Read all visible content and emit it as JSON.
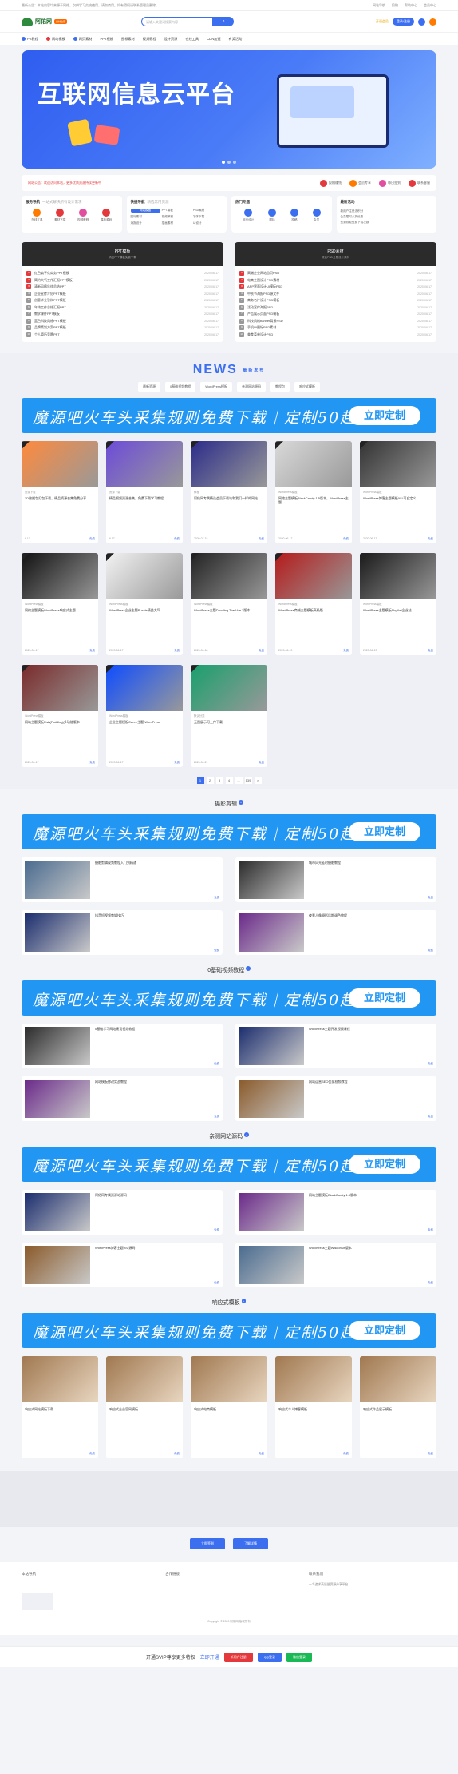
{
  "topbar": {
    "notice": "最新公告：本站内容均来源于网络，仅供学习交流使用，请勿商用。如有侵权请联系管理员删除。",
    "links": [
      "网站导航",
      "投稿",
      "帮助中心",
      "会员中心"
    ]
  },
  "header": {
    "logo": "阿佑网",
    "badge": "素材之家",
    "search_placeholder": "请输入关键词搜索内容",
    "vip": "开通会员",
    "login": "登录/注册"
  },
  "nav": [
    "PS教程",
    "网站模板",
    "网页素材",
    "PPT模板",
    "图标素材",
    "视频教程",
    "设计资源",
    "在线工具",
    "CDN加速",
    "有奖活动"
  ],
  "banner": {
    "title": "互联网信息云平台"
  },
  "strip": {
    "announce": "网站公告：欢迎访问本站，更多优质资源持续更新中",
    "tags": [
      "投稿赚钱",
      "会员专享",
      "每日签到",
      "联系客服"
    ]
  },
  "quick": [
    {
      "title": "服务导航",
      "sub": "一站式解决所有设计需求",
      "icons": [
        "在线工具",
        "素材下载",
        "视频教程",
        "模板源码"
      ]
    },
    {
      "title": "快捷导航",
      "sub": "精选常用资源",
      "links": [
        "网站模板",
        "PPT模板",
        "PSD素材",
        "图标素材",
        "视频教程",
        "字体下载",
        "海报设计",
        "插画素材",
        "UI设计"
      ]
    },
    {
      "title": "热门专题",
      "sub": "",
      "icons": [
        "网页设计",
        "图标",
        "投稿",
        "会员"
      ]
    },
    {
      "title": "最新活动",
      "sub": "",
      "lines": [
        "新用户注册送积分",
        "会员限时八折优惠",
        "签到领取免费下载次数"
      ]
    }
  ],
  "ppt": {
    "title": "PPT模板",
    "sub": "精品PPT模板免费下载",
    "items": [
      "红色扁平化商务PPT模板",
      "简约大气工作汇报PPT模板",
      "清新风格年终总结PPT",
      "企业宣传介绍PPT模板",
      "创意毕业答辩PPT模板",
      "年终工作总结汇报PPT",
      "教学课件PPT模板",
      "蓝色科技风格PPT模板",
      "品牌策划方案PPT模板",
      "个人简历竞聘PPT"
    ],
    "date": "2020-06-17"
  },
  "psd": {
    "title": "PSD素材",
    "sub": "精选PSD分层设计素材",
    "items": [
      "高端企业网站首页PSD",
      "电商主图设计PSD素材",
      "APP界面设计UI模板PSD",
      "中秋节海报PSD源文件",
      "商务名片设计PSD模板",
      "活动宣传海报PSD",
      "产品展示页面PSD模板",
      "科技风格banner背景PSD",
      "手机UI图标PSD素材",
      "美食菜单设计PSD"
    ],
    "date": "2020-06-17"
  },
  "news": {
    "title": "NEWS",
    "tag": "最新发布",
    "tabs": [
      "最新资源",
      "0基础视频教程",
      "WordPress模板",
      "亲测网站源码",
      "教程包",
      "响应式模板"
    ]
  },
  "ad": {
    "text": "魔源吧火车头采集规则免费下载｜定制50起",
    "button": "立即定制"
  },
  "cards": [
    {
      "title": "3D数据包打包下载，精品资源合集免费分享",
      "meta": "资源下载",
      "date": "6.17",
      "price": "免费"
    },
    {
      "title": "精品视频资源合集，免费下载学习教程",
      "meta": "资源下载",
      "date": "6.17",
      "price": "免费"
    },
    {
      "title": "阿佑网专属精选会员下载站和我们一样的网站",
      "meta": "教程",
      "date": "2020-07-18",
      "price": "免费"
    },
    {
      "title": "网络主题模板BlackCandy 1.5版本，WordPress主题",
      "meta": "WordPress模板",
      "date": "2020-06-17",
      "price": "免费"
    },
    {
      "title": "WordPress博客主题模板XIU可自定义",
      "meta": "WordPress模板",
      "date": "2020-06-17",
      "price": "免费"
    },
    {
      "title": "网络主题模板WordPress响应式主题",
      "meta": "WordPress模板",
      "date": "2020-06-17",
      "price": "免费"
    },
    {
      "title": "WordPress企业主题Puzzle精美大气",
      "meta": "WordPress模板",
      "date": "2020-06-17",
      "price": "免费"
    },
    {
      "title": "WordPress主题Dazzling The Vue 3版本",
      "meta": "WordPress模板",
      "date": "2020-06-18",
      "price": "免费"
    },
    {
      "title": "WordPress商城主题模板高级版",
      "meta": "WordPress模板",
      "date": "2020-06-19",
      "price": "免费"
    },
    {
      "title": "WordPress主题模板SkyNet企业站",
      "meta": "WordPress模板",
      "date": "2020-06-19",
      "price": "免费"
    },
    {
      "title": "网站主题模板Fish(FlatBlog)多功能版本",
      "meta": "WordPress模板",
      "date": "2020-06-17",
      "price": "免费"
    },
    {
      "title": "企业主题模板Caret-主题 WordPress",
      "meta": "WordPress模板",
      "date": "2020-06-17",
      "price": "免费"
    },
    {
      "title": "无图展示可上传下载",
      "meta": "默认分类",
      "date": "2020-06-21",
      "price": "免费"
    }
  ],
  "pager": [
    "1",
    "2",
    "3",
    "4",
    "...",
    "139",
    ">"
  ],
  "sections": [
    {
      "title": "摄影剪辑",
      "items": [
        "摄影剪辑视频教程入门到精通",
        "城市风光延时摄影教程",
        "抖音短视频剪辑技巧",
        "夜景人像摄影后期调色教程"
      ]
    },
    {
      "title": "0基础视频教程",
      "items": [
        "0基础学习网站建设视频教程",
        "WordPress主题开发视频课程",
        "网站模板修改实战教程",
        "网站运营SEO优化视频教程"
      ]
    },
    {
      "title": "亲测网站源码",
      "items": [
        "阿佑网专属资源站源码",
        "网站主题模板BlackCandy 1.5版本",
        "WordPress博客主题XIU源码",
        "WordPress主题Wisconsin版本"
      ]
    },
    {
      "title": "响应式模板",
      "items": [
        "响应式网站模板下载",
        "响应式企业官网模板",
        "响应式电商模板",
        "响应式个人博客模板",
        "响应式作品展示模板"
      ]
    }
  ],
  "buttons": [
    "立即签到",
    "了解详情"
  ],
  "footer": {
    "c1": "本站导航",
    "c2": "合作链接",
    "c3": "联系我们",
    "c3text": "一个追求高质量资源分享平台",
    "copy": "Copyright © 2020 阿佑网 版权所有"
  },
  "bottom": {
    "text": "开通SVIP尊享更多特权",
    "link": "立即开通",
    "b1": "新用户注册",
    "b2": "QQ登录",
    "b3": "微信登录"
  }
}
